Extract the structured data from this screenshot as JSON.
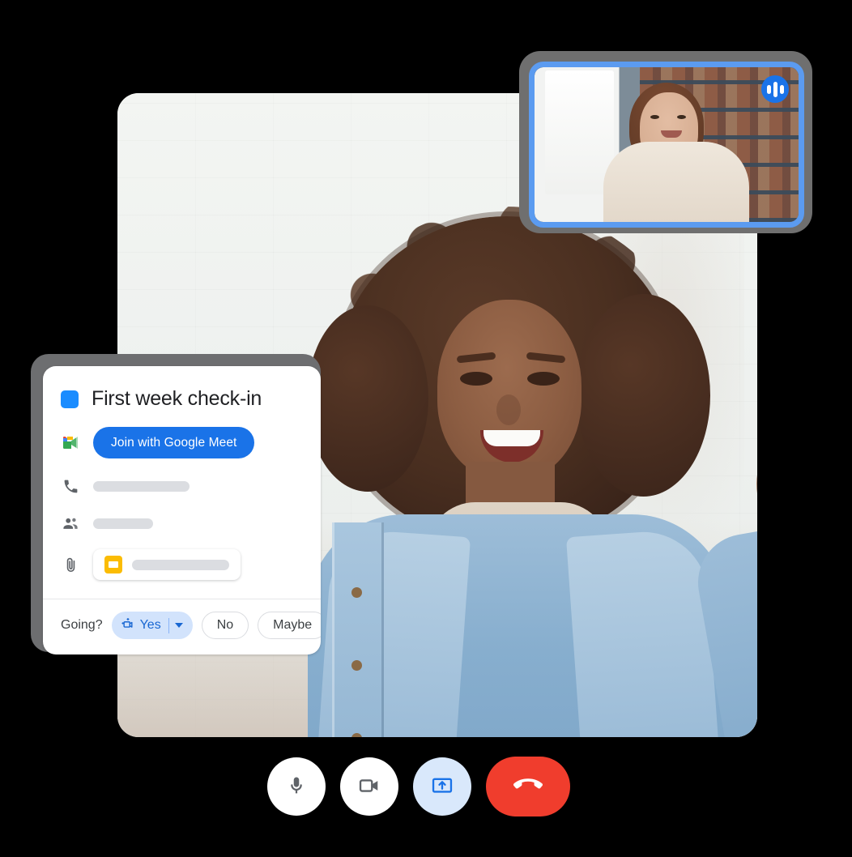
{
  "app": {
    "name": "Google Meet video call",
    "background_color": "#000000"
  },
  "main_video": {
    "name": "main-participant-video",
    "description": "Smiling woman with curly hair waving, denim jacket, white brick wall",
    "alt": "Main speaker video tile"
  },
  "pip_window": {
    "name": "self-view-thumbnail",
    "description": "Woman in beige sweater in front of bookshelves",
    "border_color": "#5b9bf0",
    "badge_icon": "audio-wave-icon",
    "badge_color": "#1a73e8"
  },
  "event_card": {
    "color_chip": "#1a8cff",
    "title": "First week check-in",
    "meet_logo_icon": "google-meet-logo-icon",
    "join_button_label": "Join with Google Meet",
    "join_button_color": "#1a73e8",
    "rows": [
      {
        "icon": "phone-icon",
        "value": ""
      },
      {
        "icon": "people-icon",
        "value": ""
      }
    ],
    "attachment": {
      "icon": "paperclip-icon",
      "file_icon": "google-slides-icon",
      "file_icon_color": "#fbbc04",
      "name": ""
    },
    "rsvp": {
      "label": "Going?",
      "yes": {
        "label": "Yes",
        "icon": "join-video-sparkle-icon",
        "selected": true,
        "bg": "#d2e3fc",
        "fg": "#1967d2",
        "caret_icon": "chevron-down-icon"
      },
      "no": {
        "label": "No",
        "selected": false
      },
      "maybe": {
        "label": "Maybe",
        "selected": false
      }
    }
  },
  "controls": [
    {
      "name": "microphone-button",
      "icon": "microphone-icon",
      "state": "on",
      "style": "light"
    },
    {
      "name": "camera-button",
      "icon": "video-camera-icon",
      "state": "on",
      "style": "light"
    },
    {
      "name": "present-button",
      "icon": "present-screen-icon",
      "state": "active",
      "style": "blue"
    },
    {
      "name": "hangup-button",
      "icon": "end-call-phone-icon",
      "state": "idle",
      "style": "red"
    }
  ]
}
